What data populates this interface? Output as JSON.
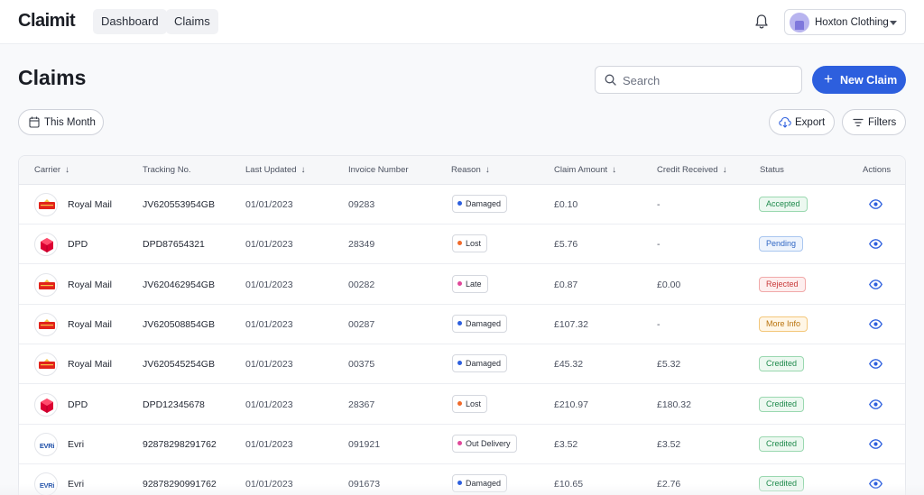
{
  "app": {
    "logo": "Claimit"
  },
  "nav": {
    "tabs": [
      {
        "label": "Dashboard"
      },
      {
        "label": "Claims"
      }
    ]
  },
  "account": {
    "name": "Hoxton Clothing"
  },
  "page": {
    "title": "Claims"
  },
  "search": {
    "placeholder": "Search",
    "value": ""
  },
  "actions": {
    "new_claim": "New Claim",
    "date_filter": "This Month",
    "export": "Export",
    "filters": "Filters"
  },
  "table": {
    "columns": [
      {
        "label": "Carrier",
        "sort": "↓"
      },
      {
        "label": "Tracking No.",
        "sort": ""
      },
      {
        "label": "Last Updated",
        "sort": "↓"
      },
      {
        "label": "Invoice Number",
        "sort": ""
      },
      {
        "label": "Reason",
        "sort": "↓"
      },
      {
        "label": "Claim Amount",
        "sort": "↓"
      },
      {
        "label": "Credit Received",
        "sort": "↓"
      },
      {
        "label": "Status",
        "sort": ""
      },
      {
        "label": "Actions",
        "sort": ""
      }
    ],
    "rows": [
      {
        "carrier": "Royal Mail",
        "carrier_icon": "royal-mail-logo",
        "tracking": "JV620553954GB",
        "updated": "01/01/2023",
        "invoice": "09283",
        "reason": "Damaged",
        "amount": "£0.10",
        "credit": "-",
        "status": "Accepted"
      },
      {
        "carrier": "DPD",
        "carrier_icon": "dpd-logo",
        "tracking": "DPD87654321",
        "updated": "01/01/2023",
        "invoice": "28349",
        "reason": "Lost",
        "amount": "£5.76",
        "credit": "-",
        "status": "Pending"
      },
      {
        "carrier": "Royal Mail",
        "carrier_icon": "royal-mail-logo",
        "tracking": "JV620462954GB",
        "updated": "01/01/2023",
        "invoice": "00282",
        "reason": "Late",
        "amount": "£0.87",
        "credit": "£0.00",
        "status": "Rejected"
      },
      {
        "carrier": "Royal Mail",
        "carrier_icon": "royal-mail-logo",
        "tracking": "JV620508854GB",
        "updated": "01/01/2023",
        "invoice": "00287",
        "reason": "Damaged",
        "amount": "£107.32",
        "credit": "-",
        "status": "More Info"
      },
      {
        "carrier": "Royal Mail",
        "carrier_icon": "royal-mail-logo",
        "tracking": "JV620545254GB",
        "updated": "01/01/2023",
        "invoice": "00375",
        "reason": "Damaged",
        "amount": "£45.32",
        "credit": "£5.32",
        "status": "Credited"
      },
      {
        "carrier": "DPD",
        "carrier_icon": "dpd-logo",
        "tracking": "DPD12345678",
        "updated": "01/01/2023",
        "invoice": "28367",
        "reason": "Lost",
        "amount": "£210.97",
        "credit": "£180.32",
        "status": "Credited"
      },
      {
        "carrier": "Evri",
        "carrier_icon": "evri-logo",
        "tracking": "92878298291762",
        "updated": "01/01/2023",
        "invoice": "091921",
        "reason": "Out Delivery",
        "amount": "£3.52",
        "credit": "£3.52",
        "status": "Credited"
      },
      {
        "carrier": "Evri",
        "carrier_icon": "evri-logo",
        "tracking": "92878290991762",
        "updated": "01/01/2023",
        "invoice": "091673",
        "reason": "Damaged",
        "amount": "£10.65",
        "credit": "£2.76",
        "status": "Credited"
      }
    ]
  },
  "colors": {
    "accent": "#2d5fde",
    "reason": {
      "Damaged": "#2d5fde",
      "Lost": "#f06a2b",
      "Late": "#e0489a",
      "Out Delivery": "#e0489a"
    },
    "status": {
      "Accepted": {
        "bg": "#ecf8f0",
        "border": "#9ad8b0",
        "text": "#1f8a4c"
      },
      "Pending": {
        "bg": "#eef4fd",
        "border": "#a9c6ef",
        "text": "#2f66c4"
      },
      "Rejected": {
        "bg": "#fdeeee",
        "border": "#f1a9a9",
        "text": "#c93a3a"
      },
      "More Info": {
        "bg": "#fff6e6",
        "border": "#f3c77a",
        "text": "#b9720c"
      },
      "Credited": {
        "bg": "#ecf8f0",
        "border": "#9ad8b0",
        "text": "#1f8a4c"
      }
    }
  }
}
